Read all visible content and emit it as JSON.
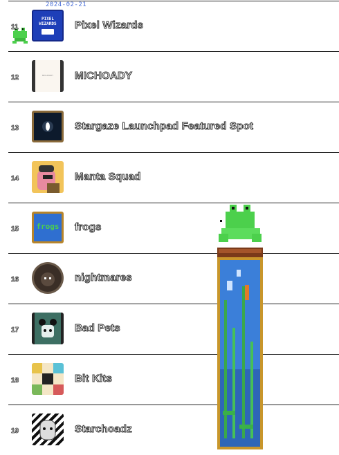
{
  "stamp": "2024-02-21",
  "rows": [
    {
      "rank": "11",
      "name": "Pixel Wizards",
      "thumb_text": "PIXEL WIZARDS"
    },
    {
      "rank": "12",
      "name": "MICHOADY",
      "thumb_text": "MICHOADY"
    },
    {
      "rank": "13",
      "name": "Stargaze Launchpad Featured Spot"
    },
    {
      "rank": "14",
      "name": "Manta Squad"
    },
    {
      "rank": "15",
      "name": "frogs",
      "thumb_text": "frogs"
    },
    {
      "rank": "16",
      "name": "nightmares"
    },
    {
      "rank": "17",
      "name": "Bad Pets"
    },
    {
      "rank": "18",
      "name": "Bit Kits"
    },
    {
      "rank": "19",
      "name": "Starchoadz"
    }
  ],
  "colors": {
    "accent": "#2a5fd6",
    "frog": "#4cd04c",
    "banner_water": "#3b7fd9",
    "banner_frame": "#c8962b"
  },
  "icons": {
    "mascot": "frog-icon",
    "banner": "frogs-banner"
  }
}
